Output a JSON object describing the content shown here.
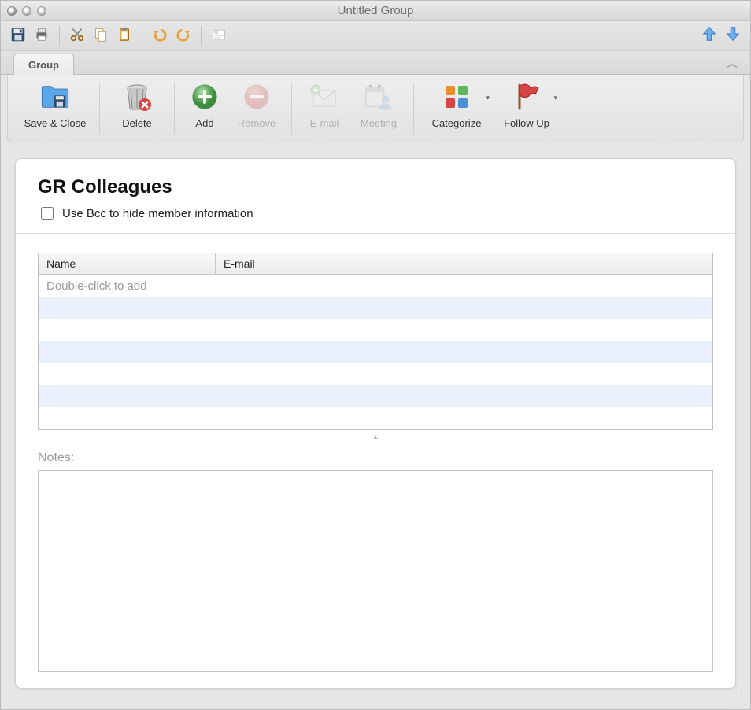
{
  "window": {
    "title": "Untitled Group"
  },
  "tabs": {
    "group": "Group"
  },
  "ribbon": {
    "save_close": "Save & Close",
    "delete": "Delete",
    "add": "Add",
    "remove": "Remove",
    "email": "E-mail",
    "meeting": "Meeting",
    "categorize": "Categorize",
    "followup": "Follow Up"
  },
  "content": {
    "group_name": "GR Colleagues",
    "bcc_label": "Use Bcc to hide member information",
    "bcc_checked": false,
    "columns": {
      "name": "Name",
      "email": "E-mail"
    },
    "placeholder_row": "Double-click to add",
    "notes_label": "Notes:",
    "notes_value": ""
  }
}
